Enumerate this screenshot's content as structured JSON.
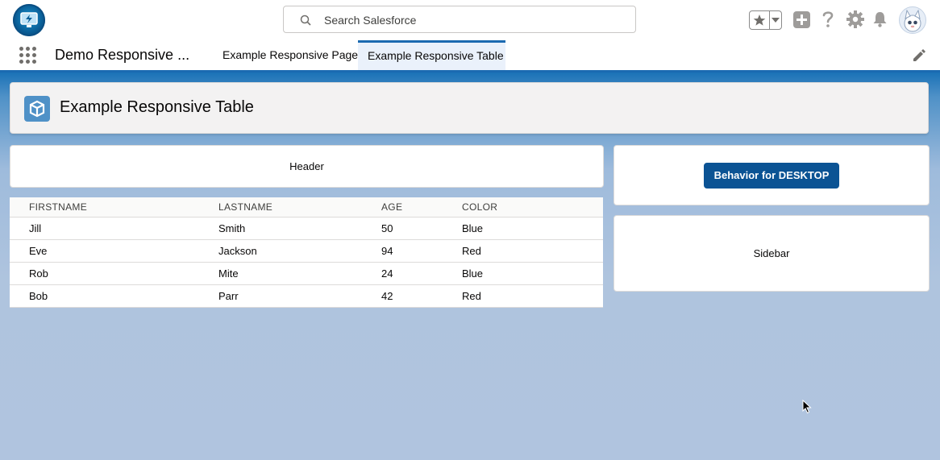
{
  "global_header": {
    "search": {
      "placeholder": "Search Salesforce"
    }
  },
  "nav": {
    "app_name": "Demo Responsive ...",
    "tabs": [
      {
        "label": "Example Responsive Page",
        "active": false
      },
      {
        "label": "Example Responsive Table",
        "active": true
      }
    ]
  },
  "page_header": {
    "title": "Example Responsive Table"
  },
  "main": {
    "header_card": {
      "label": "Header"
    },
    "table": {
      "columns": [
        "FIRSTNAME",
        "LASTNAME",
        "AGE",
        "COLOR"
      ],
      "rows": [
        [
          "Jill",
          "Smith",
          "50",
          "Blue"
        ],
        [
          "Eve",
          "Jackson",
          "94",
          "Red"
        ],
        [
          "Rob",
          "Mite",
          "24",
          "Blue"
        ],
        [
          "Bob",
          "Parr",
          "42",
          "Red"
        ]
      ]
    }
  },
  "sidebar": {
    "button_label": "Behavior for DESKTOP",
    "card_label": "Sidebar"
  },
  "colors": {
    "brand": "#0b5394",
    "nav_accent": "#1b6ab1",
    "background": "#b0c4df"
  },
  "icons": [
    "app-logo-icon",
    "search-icon",
    "star-icon",
    "chevron-down-icon",
    "add-icon",
    "help-icon",
    "gear-icon",
    "bell-icon",
    "avatar",
    "waffle-icon",
    "pencil-icon",
    "page-object-icon",
    "cursor-icon"
  ]
}
